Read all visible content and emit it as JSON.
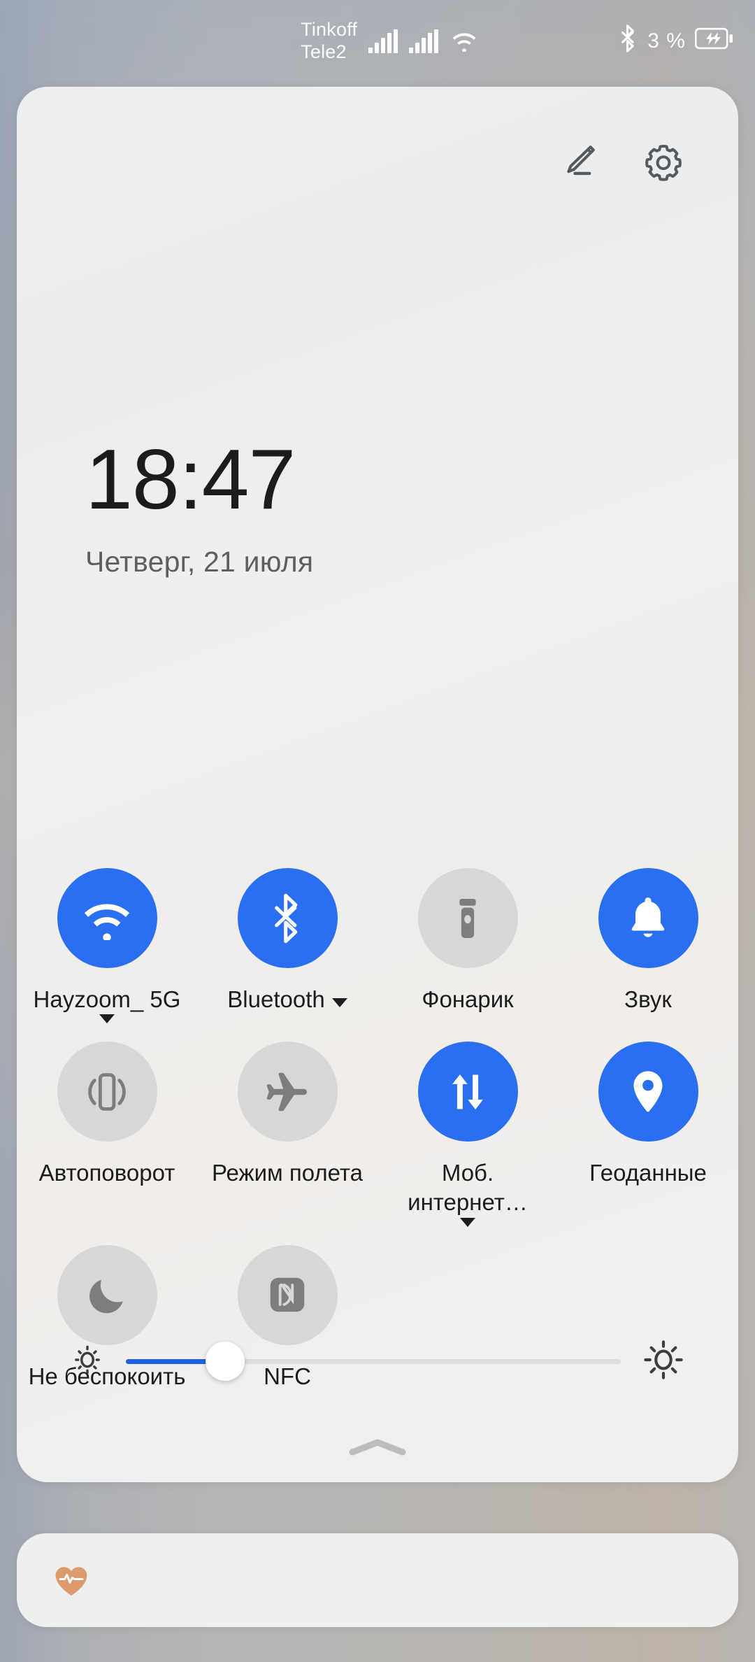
{
  "status_bar": {
    "carriers": [
      "Tinkoff",
      "Tele2"
    ],
    "signal_icon_1": "cellular-signal-icon",
    "signal_icon_2": "cellular-signal-icon",
    "wifi_icon": "wifi-icon",
    "bluetooth_icon": "bluetooth-icon",
    "battery_percent": "3 %",
    "battery_icon": "battery-charging-icon"
  },
  "panel": {
    "edit_icon": "pencil-edit-icon",
    "settings_icon": "gear-icon",
    "clock": "18:47",
    "date": "Четверг, 21 июля",
    "collapse_icon": "chevron-up-icon"
  },
  "colors": {
    "tile_on": "#2a6ff0",
    "tile_off": "#d7d7d7",
    "slider_fill": "#1f62e0",
    "notification_icon": "#dd9a6c"
  },
  "tiles": [
    [
      {
        "label": "Hayzoom_ 5G",
        "icon": "wifi-icon",
        "state": "on",
        "caret": true,
        "caret_inline": true
      },
      {
        "label": "Bluetooth",
        "icon": "bluetooth-icon",
        "state": "on",
        "caret": true,
        "caret_inline": true
      },
      {
        "label": "Фонарик",
        "icon": "flashlight-icon",
        "state": "off",
        "caret": false,
        "caret_inline": false
      },
      {
        "label": "Звук",
        "icon": "bell-icon",
        "state": "on",
        "caret": false,
        "caret_inline": false
      }
    ],
    [
      {
        "label": "Автоповорот",
        "icon": "auto-rotate-icon",
        "state": "off",
        "caret": false,
        "caret_inline": false
      },
      {
        "label": "Режим полета",
        "icon": "airplane-icon",
        "state": "off",
        "caret": false,
        "caret_inline": false
      },
      {
        "label": "Моб. интернет…",
        "icon": "mobile-data-icon",
        "state": "on",
        "caret": true,
        "caret_inline": true
      },
      {
        "label": "Геоданные",
        "icon": "location-pin-icon",
        "state": "on",
        "caret": false,
        "caret_inline": false
      }
    ],
    [
      {
        "label": "Не беспокоить",
        "icon": "moon-icon",
        "state": "off",
        "caret": false,
        "caret_inline": false
      },
      {
        "label": "NFC",
        "icon": "nfc-icon",
        "state": "off",
        "caret": false,
        "caret_inline": false
      }
    ]
  ],
  "brightness": {
    "low_icon": "brightness-low-icon",
    "high_icon": "brightness-high-icon",
    "value_percent": 20
  },
  "notification": {
    "icon": "heart-pulse-icon"
  }
}
